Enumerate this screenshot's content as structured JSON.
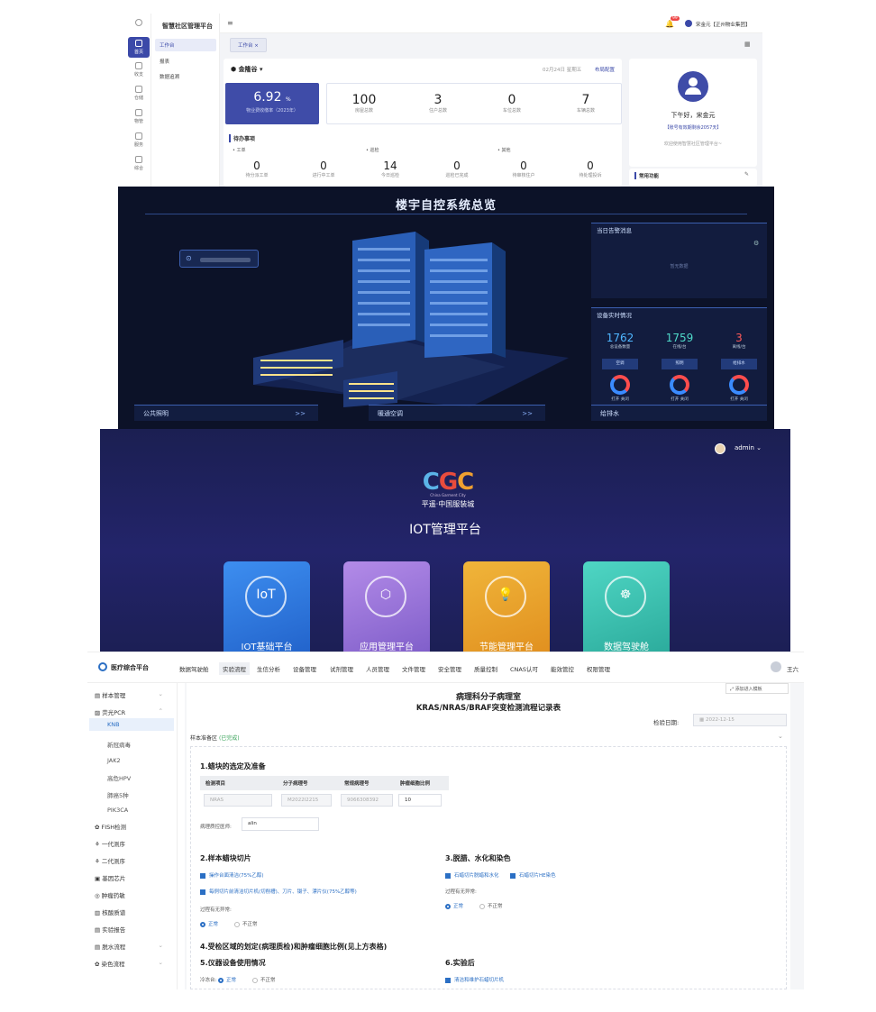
{
  "panel1": {
    "brand": "智慧社区管理平台",
    "rail": [
      "首页",
      "收支",
      "仓储",
      "物管",
      "服务",
      "综合"
    ],
    "menu": [
      "工作台",
      "报表",
      "数据追溯"
    ],
    "user": "宋金元【正州物业集团】",
    "badge": "99",
    "tab": "工作台 ×",
    "community": "金隆谷",
    "date": "02月24日 星期五",
    "link_config": "布局配置",
    "kpi_main_value": "6.92",
    "kpi_main_unit": "%",
    "kpi_main_label": "物业费收缴率（2023年）",
    "kpis": [
      {
        "value": "100",
        "label": "房屋总数"
      },
      {
        "value": "3",
        "label": "住户总数"
      },
      {
        "value": "0",
        "label": "车位总数"
      },
      {
        "value": "7",
        "label": "车辆总数"
      }
    ],
    "todo_title": "待办事项",
    "todo_groups": [
      "工单",
      "巡检",
      "其他"
    ],
    "todos": [
      {
        "value": "0",
        "label": "待分派工单"
      },
      {
        "value": "0",
        "label": "进行中工单"
      },
      {
        "value": "14",
        "label": "今日巡检"
      },
      {
        "value": "0",
        "label": "巡检已完成"
      },
      {
        "value": "0",
        "label": "待审核住户"
      },
      {
        "value": "0",
        "label": "待处理投诉"
      }
    ],
    "greet": "下午好，宋金元",
    "expire": "【账号有效期剩余2057天】",
    "welcome": "欢迎使用智慧社区管理平台~",
    "common": "常用功能"
  },
  "panel2": {
    "title": "楼宇自控系统总览",
    "alert_title": "当日告警消息",
    "alert_empty": "暂无数据",
    "device_title": "设备实时情况",
    "stats": [
      {
        "value": "1762",
        "label": "总设备数量",
        "color": "#4fb6ff"
      },
      {
        "value": "1759",
        "label": "在线/台",
        "color": "#4fd9c9"
      },
      {
        "value": "3",
        "label": "离线/台",
        "color": "#ff5a5a"
      }
    ],
    "buttons": [
      "空调",
      "照明",
      "给排水"
    ],
    "donut_legend": "打开 关闭",
    "bottom": [
      "公共照明",
      "暖通空调",
      "给排水"
    ]
  },
  "panel3": {
    "user": "admin",
    "logo": "CGC",
    "logo_sub": "China Garment City",
    "logo_cn": "平遥·中国服装城",
    "title": "IOT管理平台",
    "tiles": [
      {
        "label": "IOT基础平台",
        "icon": "IoT",
        "c1": "#3d8ef0",
        "c2": "#2161c9"
      },
      {
        "label": "应用管理平台",
        "icon": "⬡",
        "c1": "#b38be8",
        "c2": "#7d5cc8"
      },
      {
        "label": "节能管理平台",
        "icon": "💡",
        "c1": "#f0b53a",
        "c2": "#e08e1e"
      },
      {
        "label": "数据驾驶舱",
        "icon": "☸",
        "c1": "#4fd6c4",
        "c2": "#2aa99a"
      }
    ]
  },
  "panel4": {
    "app": "医疗综合平台",
    "nav": [
      "数据驾驶舱",
      "实验流程",
      "生信分析",
      "设备管理",
      "试剂管理",
      "人员管理",
      "文件管理",
      "安全管理",
      "质量控制",
      "CNAS认可",
      "能效管控",
      "权限管理"
    ],
    "user": "王六",
    "side": [
      "样本管理",
      "荧光PCR",
      "KNB",
      "新冠病毒",
      "JAK2",
      "高危HPV",
      "肺癌5种",
      "PIK3CA",
      "FISH检测",
      "一代测序",
      "二代测序",
      "基因芯片",
      "肿瘤药敏",
      "核酸质谱",
      "实验报告",
      "脱水流程",
      "染色流程"
    ],
    "lab": "病理科分子病理室",
    "form_title": "KRAS/NRAS/BRAF突变检测流程记录表",
    "date_label": "检验日期:",
    "date_value": "2022-12-15",
    "corner": "添加进入模板",
    "prep": "样本准备区",
    "prep_status": "(已完成)",
    "s1": "1.蜡块的选定及准备",
    "cols": [
      "检测项目",
      "分子病理号",
      "常规病理号",
      "肿瘤细胞比例"
    ],
    "row": [
      "NRAS",
      "M2022l2215",
      "9066308392",
      "10"
    ],
    "doctor_label": "病理质控医师:",
    "doctor": "alin",
    "s2": "2.样本蜡块切片",
    "s2a": "操作台面清洁(75%乙醇)",
    "s2b": "每例切片前清洁切片机(切削槽)、刀片、镊子、漂片仪(75%乙醇等)",
    "abn": "过程有无异常:",
    "normal": "正常",
    "abnormal": "不正常",
    "s3": "3.脱腊、水化和染色",
    "s3a": "石蜡切片脱蜡和水化",
    "s3b": "石蜡切片HE染色",
    "s4": "4.受检区域的划定(病理质检)和肿瘤细胞比例(见上方表格)",
    "s5": "5.仪器设备使用情况",
    "s5a": "冷冻台:",
    "s6": "6.实验后",
    "s6a": "清洁和维护石蜡切片机"
  }
}
